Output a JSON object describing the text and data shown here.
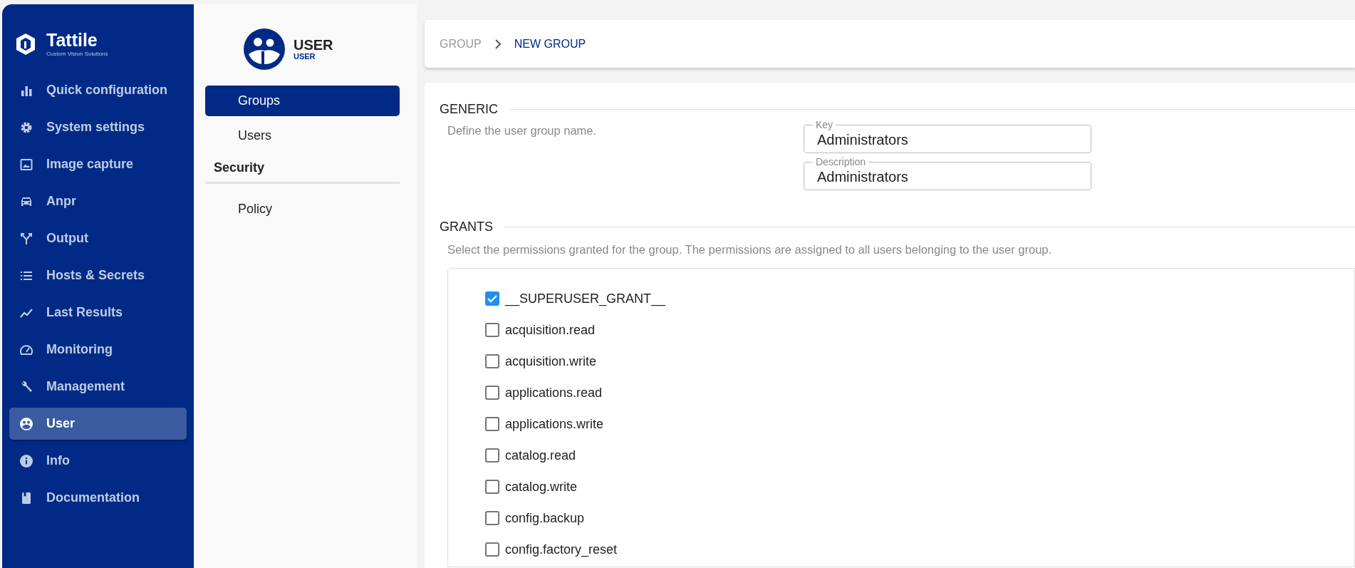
{
  "brand": {
    "name": "Tattile",
    "tagline": "Custom Vision Solutions"
  },
  "sidebar": {
    "items": [
      {
        "label": "Quick configuration",
        "selected": false
      },
      {
        "label": "System settings",
        "selected": false
      },
      {
        "label": "Image capture",
        "selected": false
      },
      {
        "label": "Anpr",
        "selected": false
      },
      {
        "label": "Output",
        "selected": false
      },
      {
        "label": "Hosts & Secrets",
        "selected": false
      },
      {
        "label": "Last Results",
        "selected": false
      },
      {
        "label": "Monitoring",
        "selected": false
      },
      {
        "label": "Management",
        "selected": false
      },
      {
        "label": "User",
        "selected": true
      },
      {
        "label": "Info",
        "selected": false
      },
      {
        "label": "Documentation",
        "selected": false
      }
    ]
  },
  "section": {
    "title": "USER",
    "subtitle": "USER",
    "menu": [
      {
        "kind": "item",
        "label": "Groups",
        "selected": true
      },
      {
        "kind": "item",
        "label": "Users",
        "selected": false
      },
      {
        "kind": "heading",
        "label": "Security"
      },
      {
        "kind": "item",
        "label": "Policy",
        "selected": false
      }
    ]
  },
  "breadcrumb": [
    {
      "label": "GROUP",
      "current": false
    },
    {
      "label": "NEW GROUP",
      "current": true
    }
  ],
  "generic": {
    "title": "GENERIC",
    "description": "Define the user group name.",
    "fields": [
      {
        "label": "Key",
        "value": "Administrators"
      },
      {
        "label": "Description",
        "value": "Administrators"
      }
    ]
  },
  "grants": {
    "title": "GRANTS",
    "description": "Select the permissions granted for the group. The permissions are assigned to all users belonging to the user group.",
    "items": [
      {
        "label": "__SUPERUSER_GRANT__",
        "checked": true
      },
      {
        "label": "acquisition.read",
        "checked": false
      },
      {
        "label": "acquisition.write",
        "checked": false
      },
      {
        "label": "applications.read",
        "checked": false
      },
      {
        "label": "applications.write",
        "checked": false
      },
      {
        "label": "catalog.read",
        "checked": false
      },
      {
        "label": "catalog.write",
        "checked": false
      },
      {
        "label": "config.backup",
        "checked": false
      },
      {
        "label": "config.factory_reset",
        "checked": false
      }
    ]
  }
}
